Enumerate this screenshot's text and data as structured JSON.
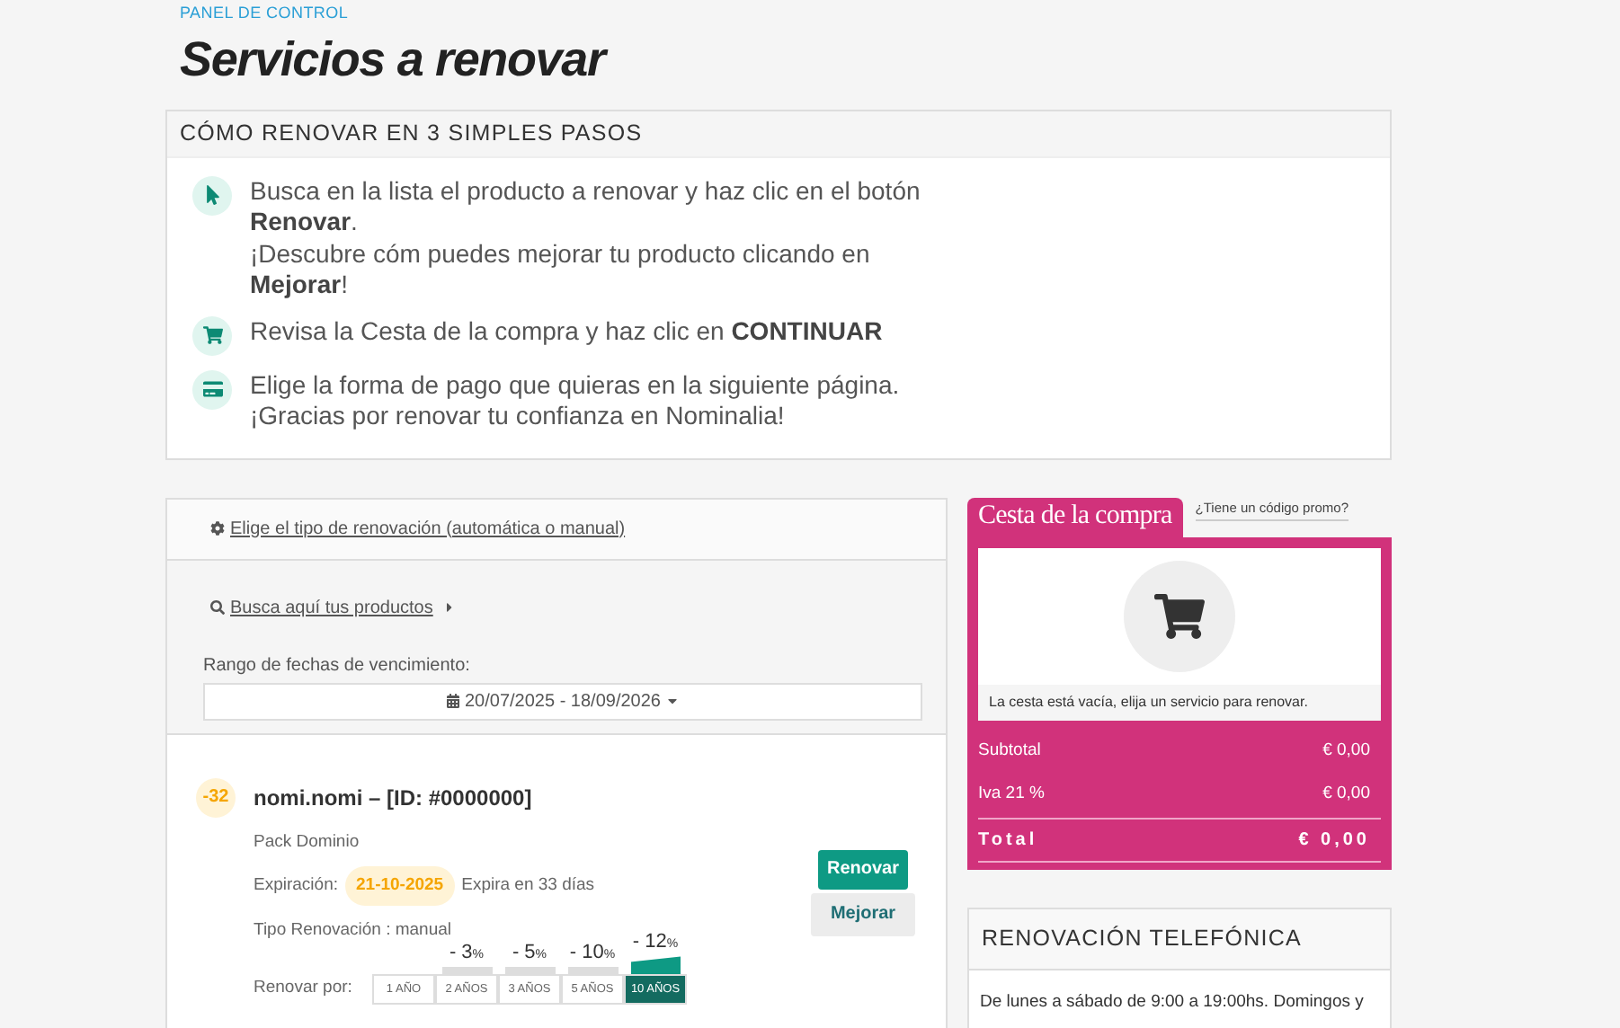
{
  "header": {
    "breadcrumb": "PANEL DE CONTROL",
    "title": "Servicios a renovar"
  },
  "steps": {
    "title": "CÓMO RENOVAR EN 3 SIMPLES PASOS",
    "items": [
      {
        "kind": "cursor",
        "lines": [
          "Busca en la lista el producto a renovar y haz clic en el botón **Renovar**.",
          "¡Descubre cóm puedes mejorar tu producto clicando en **Mejorar**!"
        ]
      },
      {
        "kind": "cart",
        "lines": [
          "Revisa la Cesta de la compra y haz clic en **CONTINUAR**"
        ]
      },
      {
        "kind": "card",
        "lines": [
          "Elige la forma de pago que quieras en la siguiente página.",
          "¡Gracias por renovar tu confianza en Nominalia!"
        ]
      }
    ]
  },
  "filters": {
    "renewal_type_link": "Elige el tipo de renovación (automática o manual)",
    "search_link": "Busca aquí tus productos",
    "date_label": "Rango de fechas de vencimiento:",
    "date_range": "20/07/2025 - 18/09/2026"
  },
  "product": {
    "days_badge": "-32",
    "name": "nomi.nomi – [ID: #0000000]",
    "type": "Pack Dominio",
    "expiration_label": "Expiración:",
    "expiration_date": "21-10-2025",
    "expires_in": "Expira en 33 días",
    "renewal_type": "Tipo Renovación : manual",
    "renew_button": "Renovar",
    "improve_button": "Mejorar",
    "renew_for_label": "Renovar por:",
    "options": [
      {
        "label": "1 AÑO",
        "selected": false
      },
      {
        "label": "2 AÑOS",
        "discount": "- 3",
        "unit": "%",
        "selected": false
      },
      {
        "label": "3 AÑOS",
        "discount": "- 5",
        "unit": "%",
        "selected": false
      },
      {
        "label": "5 AÑOS",
        "discount": "- 10",
        "unit": "%",
        "selected": false
      },
      {
        "label": "10 AÑOS",
        "discount": "- 12",
        "unit": "%",
        "selected": true
      }
    ]
  },
  "cart": {
    "title": "Cesta de la compra",
    "promo_link": "¿Tiene un código promo?",
    "empty_message": "La cesta está vacía, elija un servicio para renovar.",
    "rows": [
      {
        "label": "Subtotal",
        "value": "€ 0,00",
        "kind": "line"
      },
      {
        "label": "Iva 21 %",
        "value": "€ 0,00",
        "kind": "line"
      },
      {
        "label": "Total",
        "value": "€ 0,00",
        "kind": "total"
      }
    ]
  },
  "phone": {
    "title": "RENOVACIÓN TELEFÓNICA",
    "text": "De lunes a sábado de 9:00 a 19:00hs. Domingos y"
  }
}
